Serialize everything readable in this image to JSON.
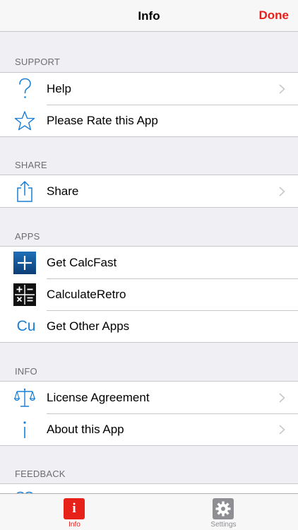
{
  "nav": {
    "title": "Info",
    "done_label": "Done"
  },
  "sections": {
    "support": {
      "header": "SUPPORT",
      "help": "Help",
      "rate": "Please Rate this App"
    },
    "share": {
      "header": "SHARE",
      "share": "Share"
    },
    "apps": {
      "header": "APPS",
      "calcfast": "Get CalcFast",
      "retro": "CalculateRetro",
      "other": "Get Other Apps",
      "other_icon_text": "Cu"
    },
    "info": {
      "header": "INFO",
      "license": "License Agreement",
      "about": "About this App"
    },
    "feedback": {
      "header": "FEEDBACK"
    }
  },
  "tabbar": {
    "info_label": "Info",
    "info_icon_text": "i",
    "settings_label": "Settings"
  },
  "colors": {
    "accent": "#e8201a",
    "icon_blue": "#1a7fd4",
    "section_text": "#6d6d72",
    "tab_inactive": "#8e8e93"
  },
  "icons": [
    "question-icon",
    "star-icon",
    "share-icon",
    "calcfast-icon",
    "calculateretro-icon",
    "cu-icon",
    "scales-icon",
    "info-icon",
    "heart-icon",
    "gear-icon"
  ]
}
